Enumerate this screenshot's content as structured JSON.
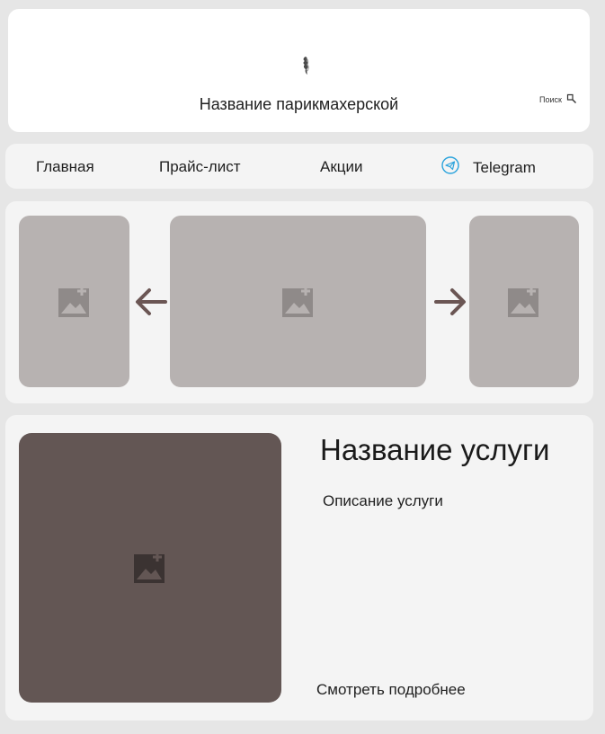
{
  "header": {
    "logo_icon": "hair-silhouette-icon",
    "brand_name": "Название парикмахерской",
    "search_label": "Поиск",
    "search_icon": "search-icon"
  },
  "nav": {
    "items": [
      {
        "label": "Главная"
      },
      {
        "label": "Прайс-лист"
      },
      {
        "label": "Акции"
      },
      {
        "label": "Telegram",
        "icon": "telegram-icon",
        "icon_color": "#2aa3dc"
      }
    ]
  },
  "carousel": {
    "prev_icon": "arrow-left-icon",
    "next_icon": "arrow-right-icon",
    "arrow_color": "#6b5654",
    "slides": [
      {
        "placeholder_icon": "image-placeholder-icon"
      },
      {
        "placeholder_icon": "image-placeholder-icon"
      },
      {
        "placeholder_icon": "image-placeholder-icon"
      }
    ],
    "slide_color": "#b7b2b1"
  },
  "service": {
    "title": "Название услуги",
    "description": "Описание услуги",
    "more_link": "Смотреть подробнее",
    "image_color": "#635654",
    "image_icon": "image-placeholder-icon"
  }
}
